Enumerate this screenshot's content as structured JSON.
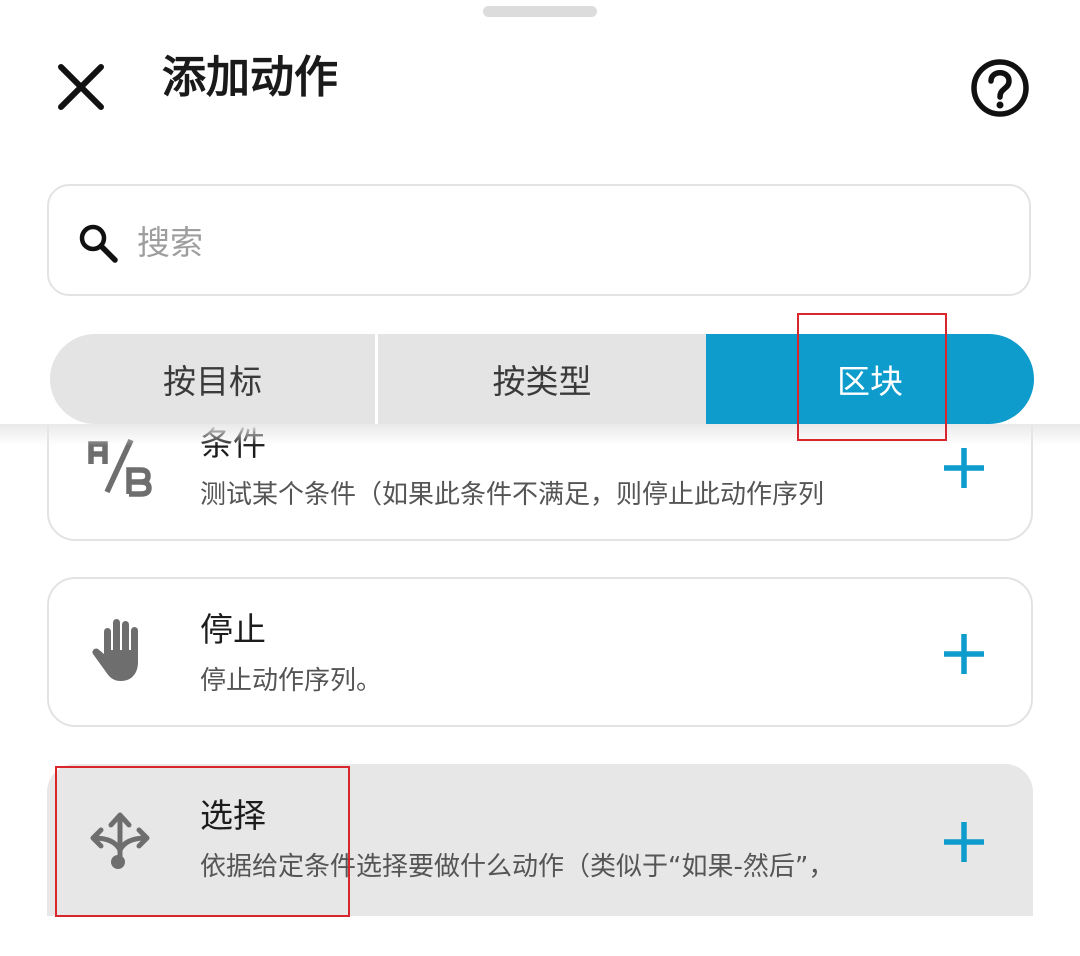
{
  "dialog": {
    "title": "添加动作",
    "close_icon": "close-icon",
    "help_icon": "help-circle-icon"
  },
  "search": {
    "placeholder": "搜索",
    "value": "",
    "icon": "search-icon"
  },
  "tabs": [
    {
      "label": "按目标",
      "selected": false
    },
    {
      "label": "按类型",
      "selected": false
    },
    {
      "label": "区块",
      "selected": true
    }
  ],
  "actions": [
    {
      "title": "条件",
      "description": "测试某个条件（如果此条件不满足，则停止此动作序列",
      "icon": "ab-test-icon"
    },
    {
      "title": "停止",
      "description": "停止动作序列。",
      "icon": "hand-stop-icon"
    },
    {
      "title": "选择",
      "description": "依据给定条件选择要做什么动作（类似于“如果-然后”，",
      "icon": "split-arrows-icon"
    }
  ],
  "add_icon": "plus-icon",
  "colors": {
    "accent": "#0d9ccc",
    "segment_bg": "#e4e4e4",
    "highlight_box": "#d9252c",
    "icon_gray": "#6e6e6e"
  }
}
